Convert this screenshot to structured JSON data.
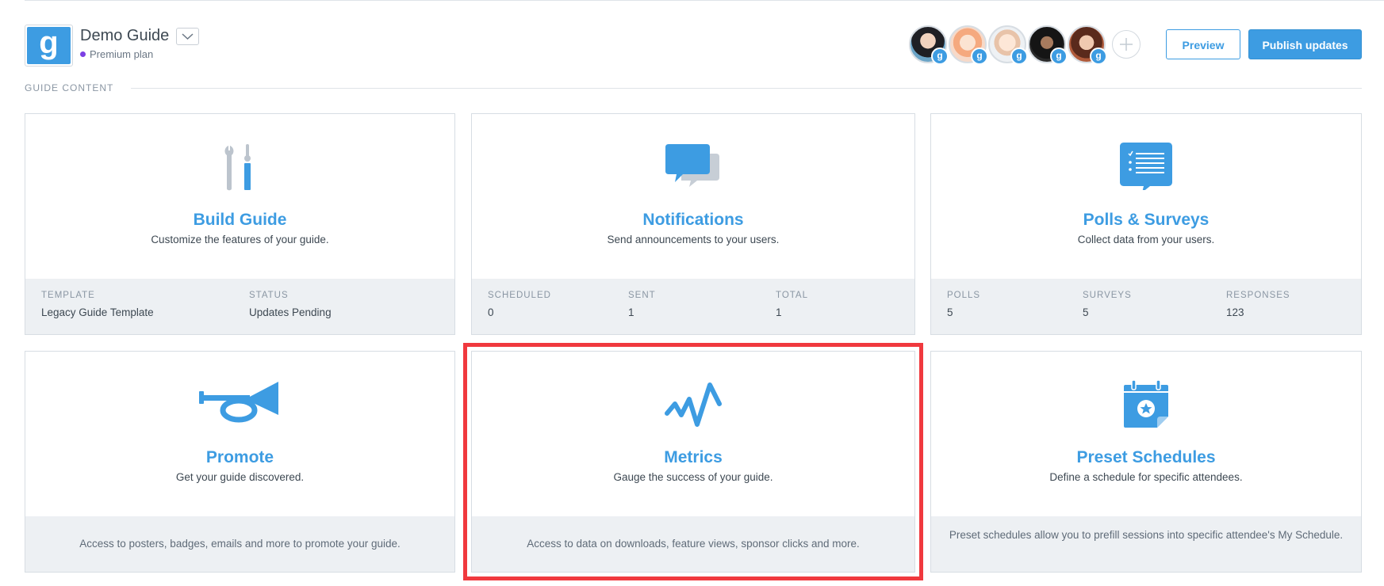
{
  "header": {
    "logo_letter": "g",
    "guide_title": "Demo Guide",
    "plan": "Premium plan",
    "preview_label": "Preview",
    "publish_label": "Publish updates",
    "collaborator_badge": "g"
  },
  "section": {
    "label": "GUIDE CONTENT"
  },
  "cards": {
    "build_guide": {
      "title": "Build Guide",
      "subtitle": "Customize the features of your guide.",
      "stats": [
        {
          "label": "TEMPLATE",
          "value": "Legacy Guide Template"
        },
        {
          "label": "STATUS",
          "value": "Updates Pending"
        }
      ]
    },
    "notifications": {
      "title": "Notifications",
      "subtitle": "Send announcements to your users.",
      "stats": [
        {
          "label": "SCHEDULED",
          "value": "0"
        },
        {
          "label": "SENT",
          "value": "1"
        },
        {
          "label": "TOTAL",
          "value": "1"
        }
      ]
    },
    "polls": {
      "title": "Polls & Surveys",
      "subtitle": "Collect data from your users.",
      "stats": [
        {
          "label": "POLLS",
          "value": "5"
        },
        {
          "label": "SURVEYS",
          "value": "5"
        },
        {
          "label": "RESPONSES",
          "value": "123"
        }
      ]
    },
    "promote": {
      "title": "Promote",
      "subtitle": "Get your guide discovered.",
      "footer": "Access to posters, badges, emails and more to promote your guide."
    },
    "metrics": {
      "title": "Metrics",
      "subtitle": "Gauge the success of your guide.",
      "footer": "Access to data on downloads, feature views, sponsor clicks and more."
    },
    "preset_schedules": {
      "title": "Preset Schedules",
      "subtitle": "Define a schedule for specific attendees.",
      "footer": "Preset schedules allow you to prefill sessions into specific attendee's My Schedule."
    }
  },
  "icons": {
    "build_guide": "tools-icon",
    "notifications": "chat-bubbles-icon",
    "polls": "checklist-bubble-icon",
    "promote": "horn-icon",
    "metrics": "pulse-line-icon",
    "preset_schedules": "calendar-star-icon"
  },
  "colors": {
    "accent": "#3d9ce2",
    "plan_dot": "#7b3fe4",
    "highlight": "#f0393e"
  }
}
